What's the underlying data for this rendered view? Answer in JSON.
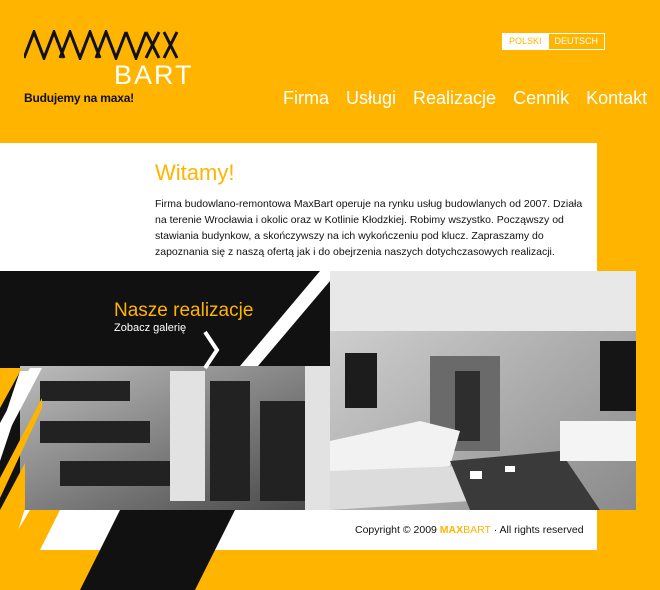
{
  "header": {
    "logo_mark": "MAXBART",
    "logo_word": "BART",
    "tagline": "Budujemy na maxa!"
  },
  "languages": [
    "POLSKI",
    "DEUTSCH"
  ],
  "nav": [
    "Firma",
    "Usługi",
    "Realizacje",
    "Cennik",
    "Kontakt"
  ],
  "content": {
    "title": "Witamy!",
    "intro": "Firma budowlano-remontowa MaxBart operuje na rynku usług budowlanych od 2007. Działa na terenie Wrocławia i okolic oraz w Kotlinie Kłodzkiej. Robimy wszystko. Począwszy od stawiania budynkow, a skończywszy na ich wykończeniu pod klucz. Zapraszamy do zapoznania się z naszą ofertą jak i do obejrzenia naszych dotychczasowych realizacji."
  },
  "banner": {
    "title": "Nasze realizacje",
    "link": "Zobacz galerię"
  },
  "footer": {
    "prefix": "Copyright © 2009",
    "brand_max": "MAX",
    "brand_bart": "BART",
    "suffix": "· All rights reserved"
  },
  "colors": {
    "accent": "#ffb400",
    "dark": "#111111",
    "white": "#ffffff"
  }
}
